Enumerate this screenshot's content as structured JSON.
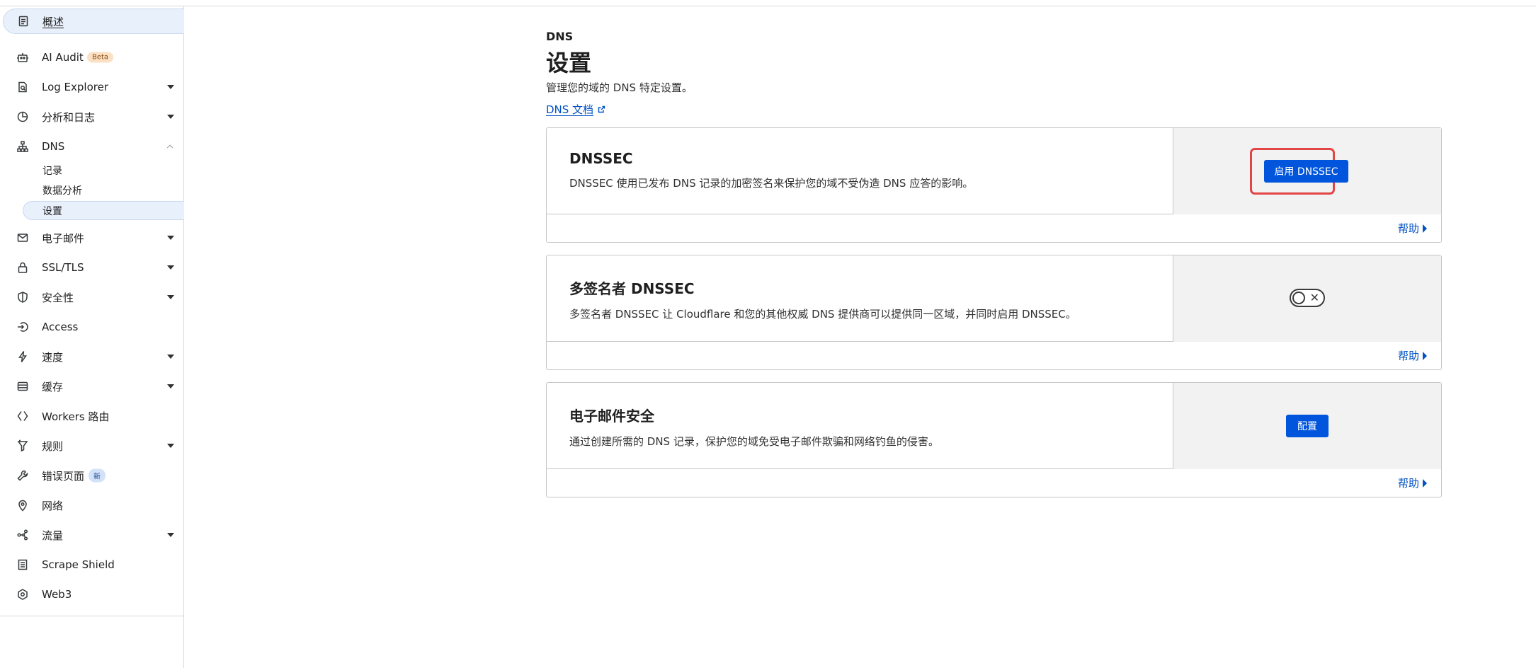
{
  "sidebar": {
    "items": [
      {
        "label": "概述",
        "icon": "clipboard-icon"
      },
      {
        "label": "AI Audit",
        "badge": "Beta",
        "icon": "robot-icon"
      },
      {
        "label": "Log Explorer",
        "icon": "document-search-icon"
      },
      {
        "label": "分析和日志",
        "icon": "pie-chart-icon"
      },
      {
        "label": "DNS",
        "icon": "network-icon"
      },
      {
        "label": "电子邮件",
        "icon": "mail-icon"
      },
      {
        "label": "SSL/TLS",
        "icon": "lock-icon"
      },
      {
        "label": "安全性",
        "icon": "shield-icon"
      },
      {
        "label": "Access",
        "icon": "access-icon"
      },
      {
        "label": "速度",
        "icon": "bolt-icon"
      },
      {
        "label": "缓存",
        "icon": "database-icon"
      },
      {
        "label": "Workers 路由",
        "icon": "workers-icon"
      },
      {
        "label": "规则",
        "icon": "funnel-icon"
      },
      {
        "label": "错误页面",
        "badge": "新",
        "icon": "wrench-icon"
      },
      {
        "label": "网络",
        "icon": "location-pin-icon"
      },
      {
        "label": "流量",
        "icon": "share-icon"
      },
      {
        "label": "Scrape Shield",
        "icon": "page-icon"
      },
      {
        "label": "Web3",
        "icon": "web3-icon"
      }
    ],
    "dns_sub": [
      "记录",
      "数据分析",
      "设置"
    ]
  },
  "header": {
    "breadcrumb": "DNS",
    "title": "设置",
    "description": "管理您的域的 DNS 特定设置。",
    "doc_link": "DNS 文档"
  },
  "cards": [
    {
      "title": "DNSSEC",
      "description": "DNSSEC 使用已发布 DNS 记录的加密签名来保护您的域不受伪造 DNS 应答的影响。",
      "action_label": "启用 DNSSEC",
      "help": "帮助"
    },
    {
      "title": "多签名者 DNSSEC",
      "description": "多签名者 DNSSEC 让 Cloudflare 和您的其他权威 DNS 提供商可以提供同一区域，并同时启用 DNSSEC。",
      "toggle_state": "off",
      "help": "帮助"
    },
    {
      "title": "电子邮件安全",
      "description": "通过创建所需的 DNS 记录，保护您的域免受电子邮件欺骗和网络钓鱼的侵害。",
      "action_label": "配置",
      "help": "帮助"
    }
  ],
  "colors": {
    "primary_button": "#0055dc",
    "link": "#0051c3",
    "highlight": "#e24545",
    "active_nav": "#e8f0fb"
  }
}
